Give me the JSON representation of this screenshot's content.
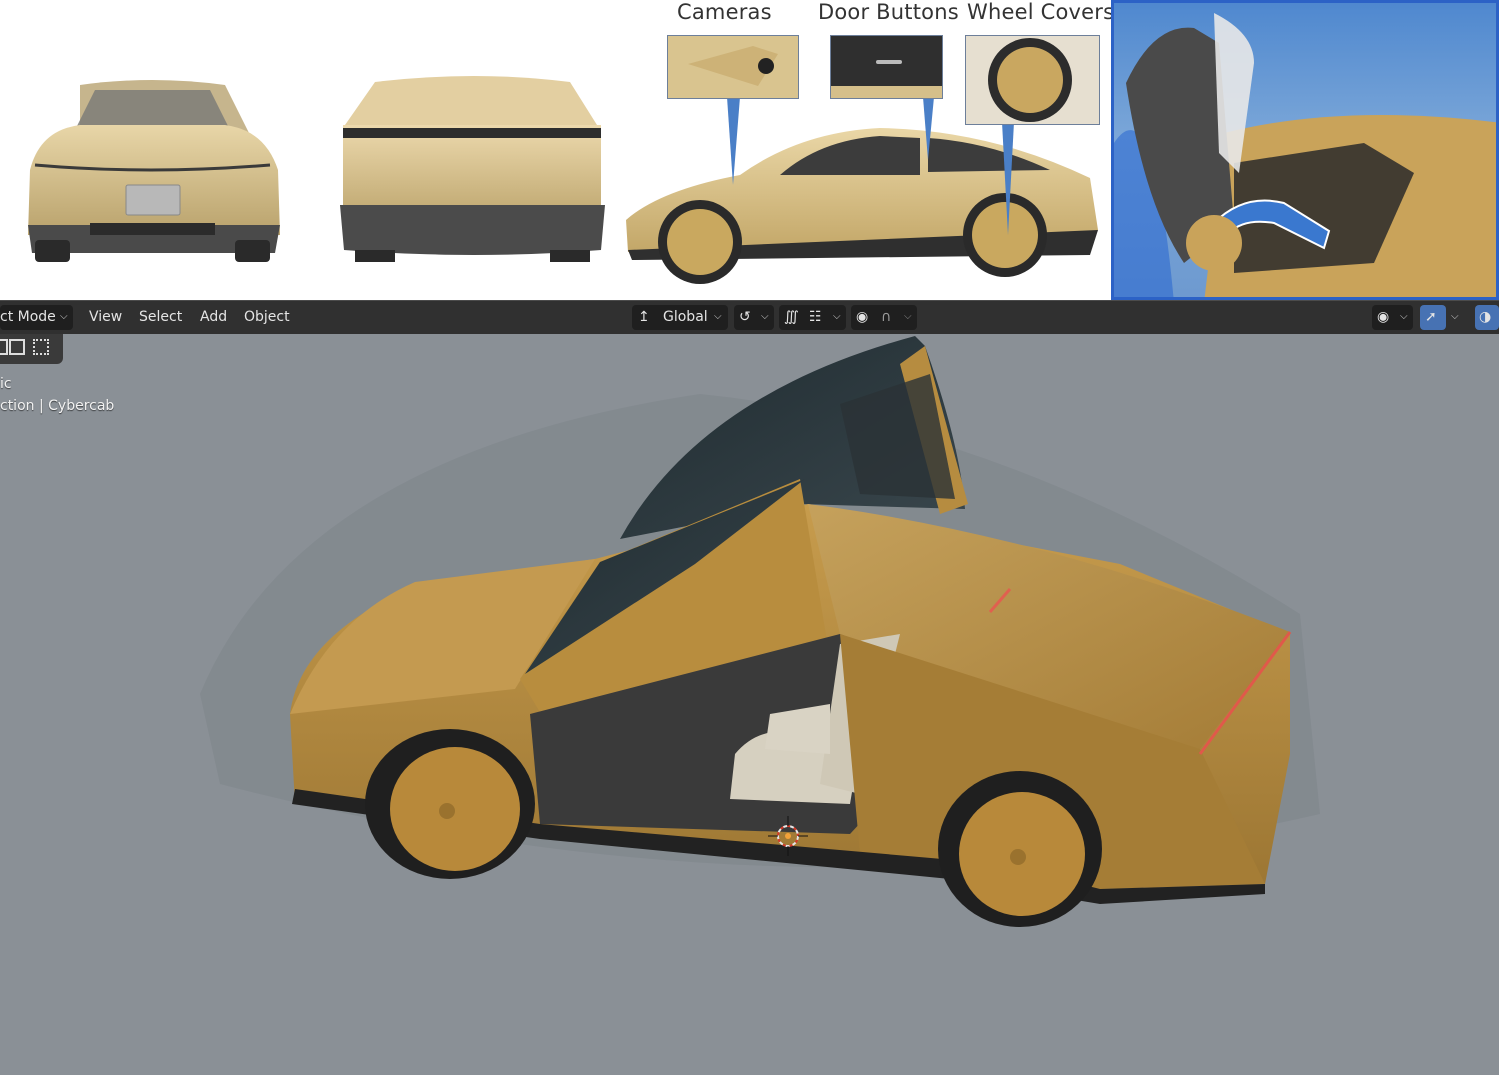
{
  "reference": {
    "callouts": [
      {
        "label": "Cameras"
      },
      {
        "label": "Door Buttons"
      },
      {
        "label": "Wheel Covers"
      }
    ]
  },
  "header": {
    "mode_label": "ct Mode",
    "menus": [
      "View",
      "Select",
      "Add",
      "Object"
    ],
    "transform_orientation": "Global"
  },
  "viewport": {
    "view_name": "ic",
    "collection_text": "ction | Cybercab"
  },
  "colors": {
    "car_body": "#b58a3c",
    "header_bg": "#303030",
    "viewport_bg": "#8a9096",
    "accent_blue": "#4772b3"
  }
}
